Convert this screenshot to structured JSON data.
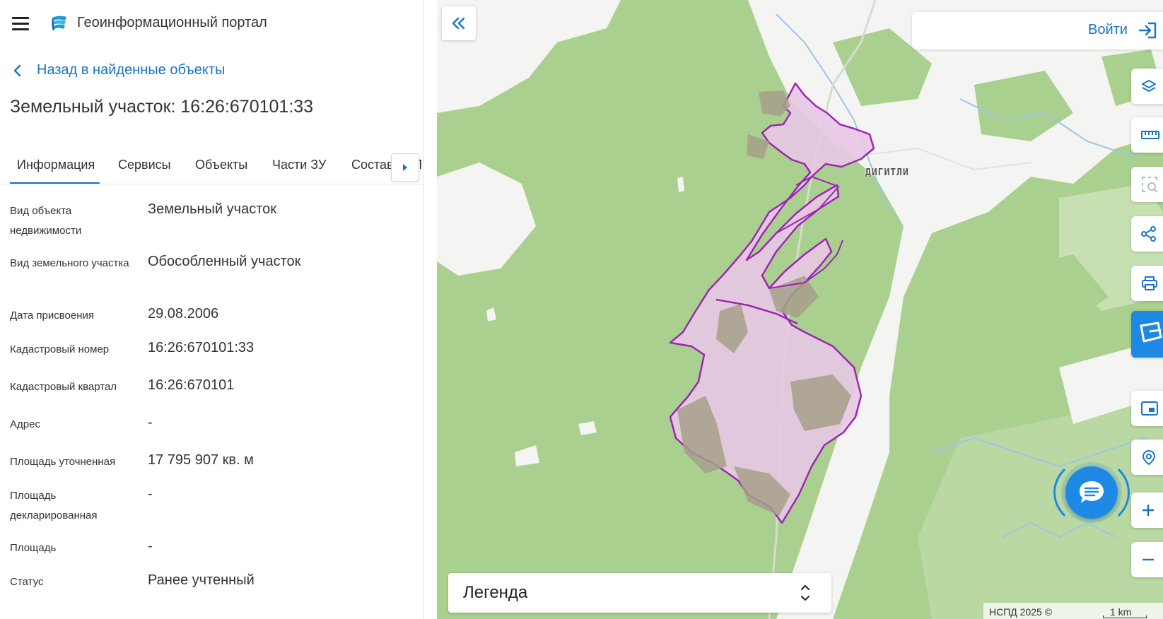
{
  "header": {
    "app_title": "Геоинформационный портал",
    "menu_icon": "hamburger-menu-icon",
    "logo_icon": "portal-logo-icon"
  },
  "back_link": {
    "label": "Назад в найденные объекты",
    "icon": "chevron-left-icon"
  },
  "object_title": "Земельный участок: 16:26:670101:33",
  "tabs": [
    {
      "label": "Информация",
      "active": true
    },
    {
      "label": "Сервисы",
      "active": false
    },
    {
      "label": "Объекты",
      "active": false
    },
    {
      "label": "Части ЗУ",
      "active": false
    },
    {
      "label": "Состав ЕЗП",
      "active": false
    }
  ],
  "info_rows": [
    {
      "key": "Вид объекта недвижимости",
      "value": "Земельный участок"
    },
    {
      "key": "Вид земельного участка",
      "value": "Обособленный участок"
    },
    {
      "key": "Дата присвоения",
      "value": "29.08.2006"
    },
    {
      "key": "Кадастровый номер",
      "value": "16:26:670101:33"
    },
    {
      "key": "Кадастровый квартал",
      "value": "16:26:670101"
    },
    {
      "key": "Адрес",
      "value": "-"
    },
    {
      "key": "Площадь уточненная",
      "value": "17 795 907 кв. м"
    },
    {
      "key": "Площадь декларированная",
      "value": "-"
    },
    {
      "key": "Площадь",
      "value": "-"
    },
    {
      "key": "Статус",
      "value": "Ранее учтенный"
    }
  ],
  "map": {
    "login_label": "Войти",
    "place_label": "ДИГИТЛИ",
    "legend_label": "Легенда",
    "attribution": "НСПД 2025 ©",
    "scale_label": "1 km",
    "colors": {
      "forest": "#a9d08e",
      "open_land": "#f4f4f2",
      "parcel_fill": "#e8c6e6",
      "parcel_stroke": "#9c27b0",
      "accent": "#1a73c8"
    },
    "tools": [
      "layers-icon",
      "ruler-icon",
      "select-area-icon",
      "share-icon",
      "print-icon",
      "search-map-icon",
      "minimap-icon",
      "geolocation-icon",
      "zoom-in-icon",
      "zoom-out-icon"
    ]
  }
}
